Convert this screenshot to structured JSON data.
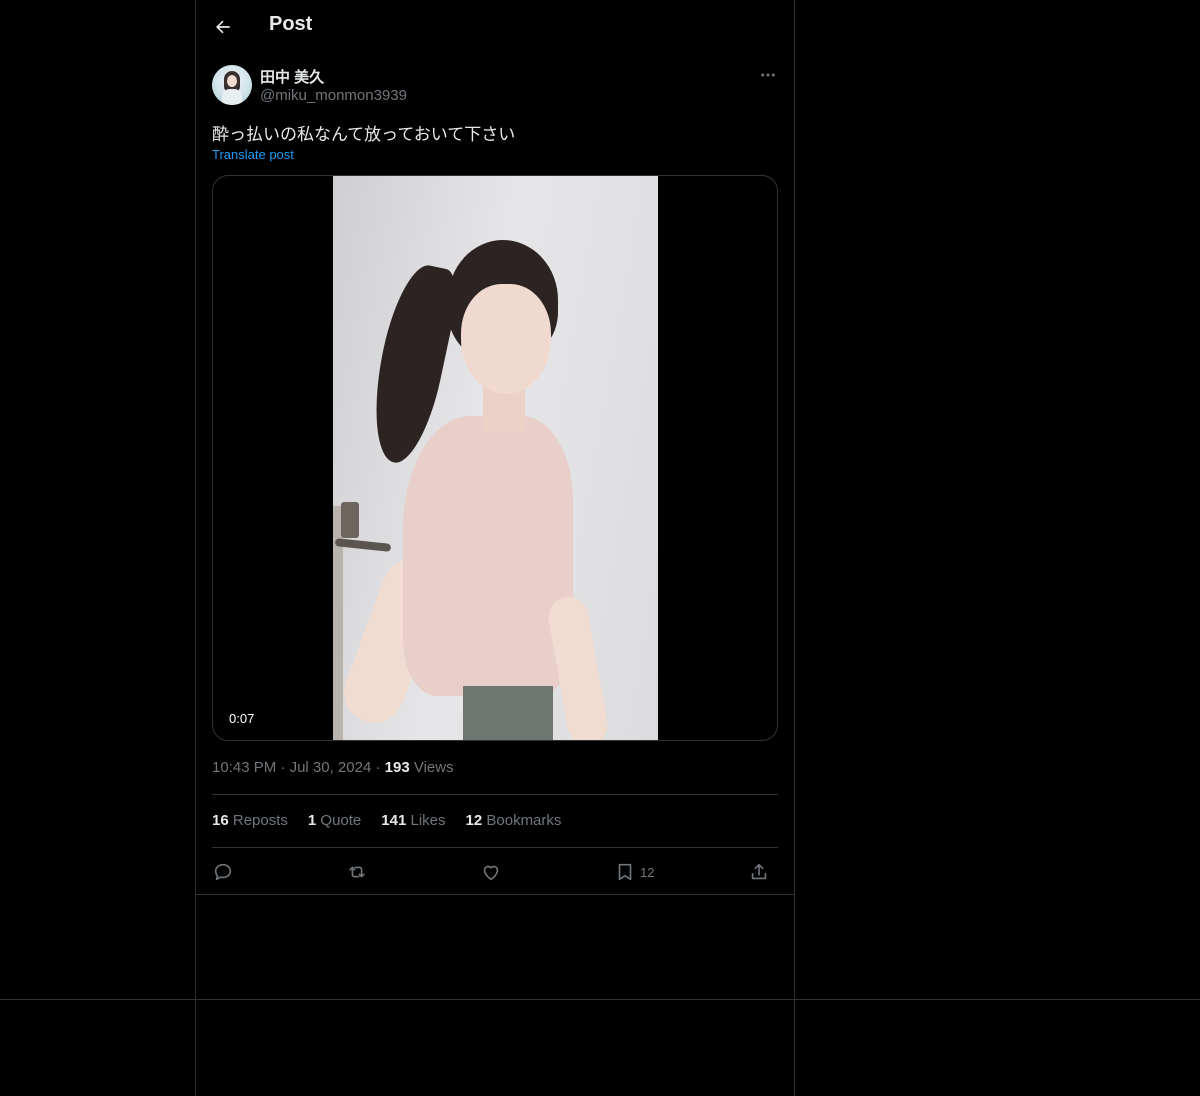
{
  "header": {
    "title": "Post",
    "back_icon": "arrow-left-icon"
  },
  "author": {
    "name": "田中 美久",
    "handle": "@miku_monmon3939"
  },
  "post": {
    "text": "酔っ払いの私なんて放っておいて下さい",
    "translate_label": "Translate post",
    "video_time": "0:07"
  },
  "meta": {
    "time": "10:43 PM",
    "dot1": "·",
    "date": "Jul 30, 2024",
    "dot2": "·",
    "views_count": "193",
    "views_label": "Views"
  },
  "stats": {
    "reposts_count": "16",
    "reposts_label": "Reposts",
    "quote_count": "1",
    "quote_label": "Quote",
    "likes_count": "141",
    "likes_label": "Likes",
    "bookmarks_count": "12",
    "bookmarks_label": "Bookmarks"
  },
  "actions": {
    "reply_icon": "reply-icon",
    "repost_icon": "repost-icon",
    "like_icon": "heart-icon",
    "bookmark_icon": "bookmark-icon",
    "bookmark_count": "12",
    "share_icon": "share-icon"
  },
  "colors": {
    "background": "#000000",
    "text": "#e7e9ea",
    "muted": "#71767b",
    "link": "#1d9bf0",
    "border": "#2f3336"
  }
}
